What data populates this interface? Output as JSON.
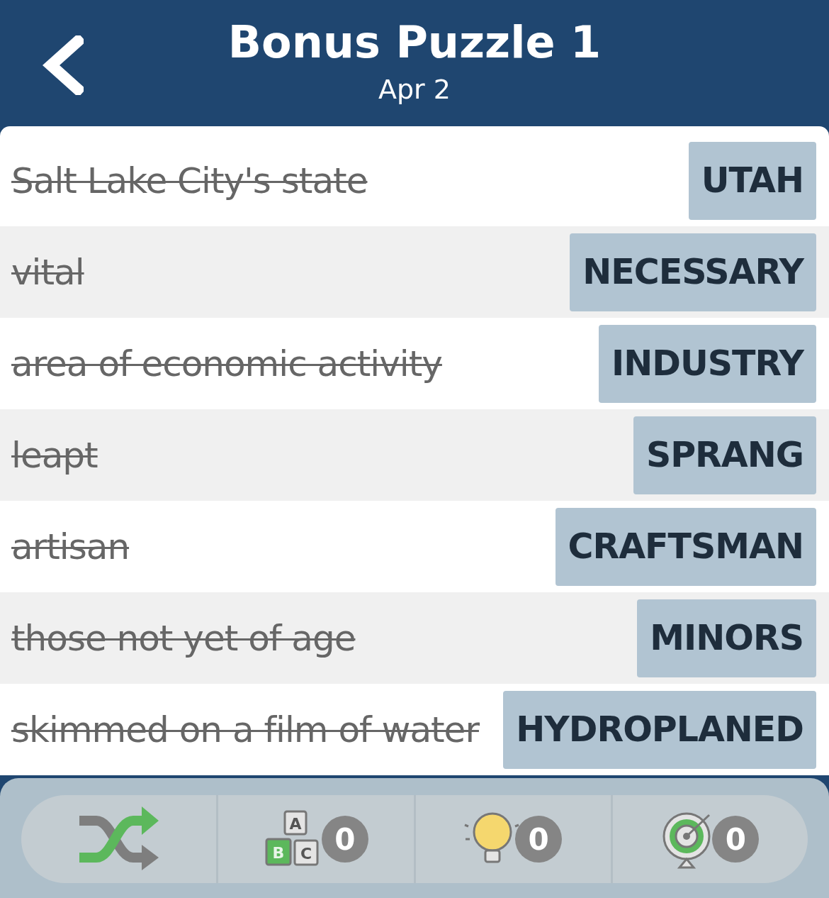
{
  "header": {
    "title": "Bonus Puzzle 1",
    "subtitle": "Apr 2"
  },
  "clues": [
    {
      "clue": "Salt Lake City's state",
      "answer": "UTAH",
      "solved": true
    },
    {
      "clue": "vital",
      "answer": "NECESSARY",
      "solved": true
    },
    {
      "clue": "area of economic activity",
      "answer": "INDUSTRY",
      "solved": true
    },
    {
      "clue": "leapt",
      "answer": "SPRANG",
      "solved": true
    },
    {
      "clue": "artisan",
      "answer": "CRAFTSMAN",
      "solved": true
    },
    {
      "clue": "those not yet of age",
      "answer": "MINORS",
      "solved": true
    },
    {
      "clue": "skimmed on a film of water",
      "answer": "HYDROPLANED",
      "solved": true
    }
  ],
  "toolbar": [
    {
      "kind": "shuffle"
    },
    {
      "kind": "letters",
      "letters": [
        "A",
        "B",
        "C"
      ],
      "count": "0"
    },
    {
      "kind": "hint",
      "count": "0"
    },
    {
      "kind": "target",
      "count": "0"
    }
  ]
}
